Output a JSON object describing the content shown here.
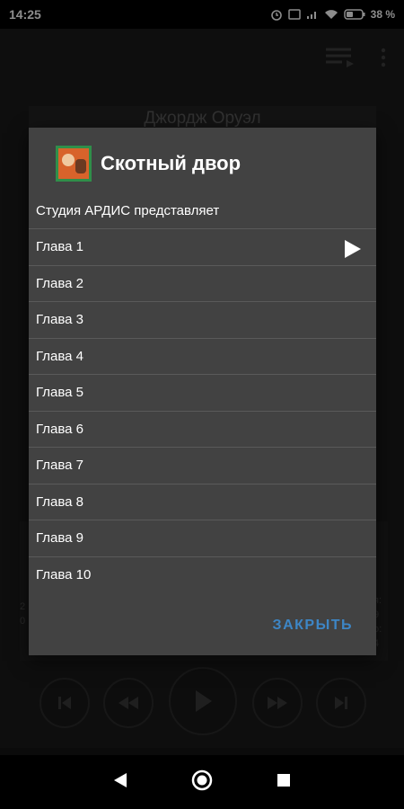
{
  "status_bar": {
    "time": "14:25",
    "battery": "38 %"
  },
  "background": {
    "author": "Джордж Оруэл"
  },
  "dialog": {
    "title": "Скотный двор",
    "subtitle": "Студия АРДИС представляет",
    "chapters": [
      "Глава 1",
      "Глава 2",
      "Глава 3",
      "Глава 4",
      "Глава 5",
      "Глава 6",
      "Глава 7",
      "Глава 8",
      "Глава 9",
      "Глава 10"
    ],
    "close_label": "ЗАКРЫТЬ"
  },
  "colors": {
    "accent": "#3d86c6",
    "dialog_bg": "#424242"
  }
}
